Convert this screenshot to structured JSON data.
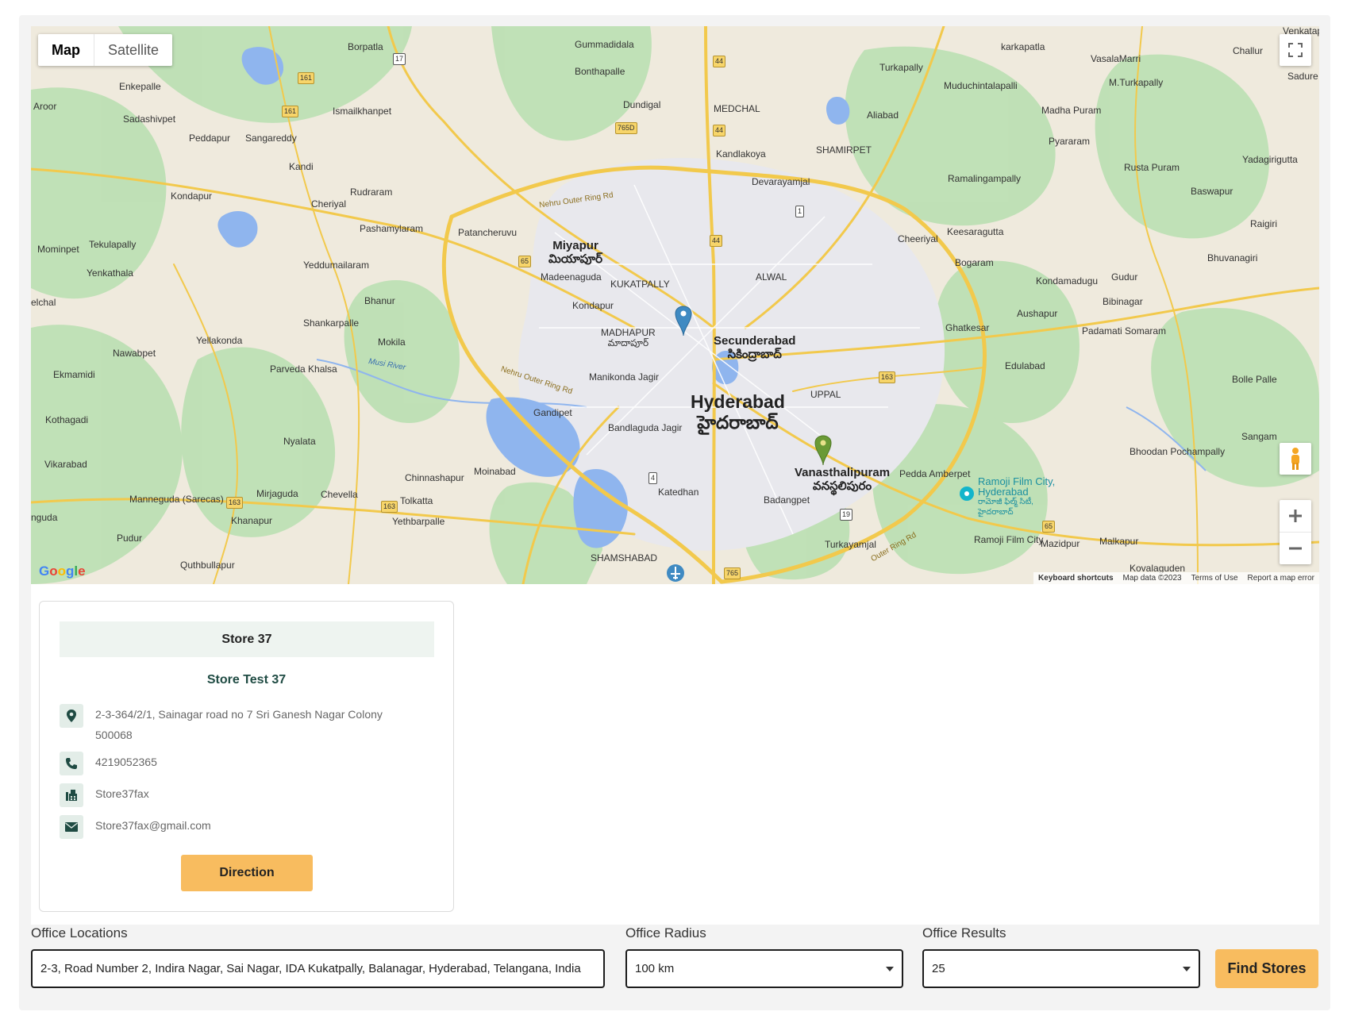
{
  "map": {
    "toggle": {
      "map_label": "Map",
      "satellite_label": "Satellite"
    },
    "labels": [
      {
        "text": "Gummadidala"
      },
      {
        "text": "Borpatla"
      },
      {
        "text": "Enkepalle"
      },
      {
        "text": "Aroor"
      },
      {
        "text": "Sadashivpet"
      },
      {
        "text": "Ismailkhanpet"
      },
      {
        "text": "Peddapur"
      },
      {
        "text": "Sangareddy"
      },
      {
        "text": "Kandi"
      },
      {
        "text": "Kondapur"
      },
      {
        "text": "Rudraram"
      },
      {
        "text": "Cheriyal"
      },
      {
        "text": "Pashamylaram"
      },
      {
        "text": "Patancheruvu"
      },
      {
        "text": "Mominpet"
      },
      {
        "text": "Tekulapally"
      },
      {
        "text": "Yenkathala"
      },
      {
        "text": "Yeddumailaram"
      },
      {
        "text": "Madeenaguda"
      },
      {
        "text": "Kondapur"
      },
      {
        "text": "Bhanur"
      },
      {
        "text": "Shankarpalle"
      },
      {
        "text": "Yellakonda"
      },
      {
        "text": "Nawabpet"
      },
      {
        "text": "Mokila"
      },
      {
        "text": "Ekmamidi"
      },
      {
        "text": "Parveda Khalsa"
      },
      {
        "text": "Kothagadi"
      },
      {
        "text": "Vikarabad"
      },
      {
        "text": "Nyalata"
      },
      {
        "text": "Chinnashapur"
      },
      {
        "text": "Moinabad"
      },
      {
        "text": "Gandipet"
      },
      {
        "text": "Manikonda Jagir"
      },
      {
        "text": "Bandlaguda Jagir"
      },
      {
        "text": "Manneguda (Sarecas)"
      },
      {
        "text": "Mirjaguda"
      },
      {
        "text": "Chevella"
      },
      {
        "text": "Tolkatta"
      },
      {
        "text": "Yethbarpalle"
      },
      {
        "text": "Khanapur"
      },
      {
        "text": "Pudur"
      },
      {
        "text": "Quthbullapur"
      },
      {
        "text": "Katedhan"
      },
      {
        "text": "Bonthapalle"
      },
      {
        "text": "Dundigal"
      },
      {
        "text": "MEDCHAL"
      },
      {
        "text": "Kandlakoya"
      },
      {
        "text": "Devarayamjal"
      },
      {
        "text": "Turkapally"
      },
      {
        "text": "Aliabad"
      },
      {
        "text": "SHAMIRPET"
      },
      {
        "text": "Muduchintalapalli"
      },
      {
        "text": "karkapatla"
      },
      {
        "text": "VasalaMarri"
      },
      {
        "text": "M.Turkapally"
      },
      {
        "text": "Madha Puram"
      },
      {
        "text": "Pyararam"
      },
      {
        "text": "Ramalingampally"
      },
      {
        "text": "Rusta Puram"
      },
      {
        "text": "Yadagirigutta"
      },
      {
        "text": "Baswapur"
      },
      {
        "text": "Raigiri"
      },
      {
        "text": "Bhuvanagiri"
      },
      {
        "text": "Cheeriyal"
      },
      {
        "text": "Keesaragutta"
      },
      {
        "text": "Bogaram"
      },
      {
        "text": "Kondamadugu"
      },
      {
        "text": "Gudur"
      },
      {
        "text": "Bibinagar"
      },
      {
        "text": "Aushapur"
      },
      {
        "text": "Ghatkesar"
      },
      {
        "text": "Padamati Somaram"
      },
      {
        "text": "Edulabad"
      },
      {
        "text": "Bolle Palle"
      },
      {
        "text": "Sangam"
      },
      {
        "text": "Bhoodan Pochampally"
      },
      {
        "text": "Pedda Amberpet"
      },
      {
        "text": "Badangpet"
      },
      {
        "text": "Turkayamjal"
      },
      {
        "text": "Mazidpur"
      },
      {
        "text": "Malkapur"
      },
      {
        "text": "Ramoji Film City"
      },
      {
        "text": "Kovalaguden"
      },
      {
        "text": "ALWAL"
      },
      {
        "text": "KUKATPALLY"
      },
      {
        "text": "UPPAL"
      },
      {
        "text": "SHAMSHABAD"
      },
      {
        "text": "Challur"
      },
      {
        "text": "Sadure"
      },
      {
        "text": "Venkatap"
      },
      {
        "text": "elchal"
      },
      {
        "text": "nguda"
      }
    ],
    "major_labels": [
      {
        "text": "Miyapur",
        "sub": "మియాపూర్"
      },
      {
        "text": "MADHAPUR",
        "sub": "మాదాపూర్"
      },
      {
        "text": "Secunderabad",
        "sub": "సికింద్రాబాద్"
      },
      {
        "text": "Vanasthalipuram",
        "sub": "వనస్థలిపురం"
      }
    ],
    "city": {
      "text": "Hyderabad",
      "sub": "హైదరాబాద్"
    },
    "poi": {
      "text": "Ramoji Film City, Hyderabad",
      "sub": "రామోజీ ఫిల్మ్ సిటీ, హైదరాబాద్"
    },
    "roads": [
      "Nehru Outer Ring Rd",
      "Nehru Outer Ring Rd",
      "Outer Ring Rd",
      "Musi River"
    ],
    "shields": [
      "161",
      "161",
      "17",
      "44",
      "44",
      "44",
      "765D",
      "65",
      "163",
      "163",
      "163",
      "4",
      "19",
      "65",
      "765",
      "1"
    ],
    "attribution": {
      "google": "Google",
      "keyboard": "Keyboard shortcuts",
      "data": "Map data ©2023",
      "terms": "Terms of Use",
      "report": "Report a map error"
    },
    "colors": {
      "land": "#efeadd",
      "green": "#9fd7a3",
      "urban": "#e9e9ee",
      "water": "#8fb5ee",
      "road": "#f2c94c",
      "pin_blue": "#3f8ac2",
      "pin_green": "#6a9a35"
    }
  },
  "store": {
    "header": "Store 37",
    "name": "Store Test 37",
    "address": "2-3-364/2/1, Sainagar road no 7 Sri Ganesh Nagar Colony 500068",
    "phone": "4219052365",
    "fax": "Store37fax",
    "email": "Store37fax@gmail.com",
    "direction_label": "Direction",
    "icons": [
      "map-pin-icon",
      "phone-icon",
      "fax-icon",
      "envelope-icon"
    ]
  },
  "form": {
    "location_label": "Office Locations",
    "location_value": "2-3, Road Number 2, Indira Nagar, Sai Nagar, IDA Kukatpally, Balanagar, Hyderabad, Telangana, India",
    "radius_label": "Office Radius",
    "radius_value": "100 km",
    "results_label": "Office Results",
    "results_value": "25",
    "find_label": "Find Stores"
  },
  "colors": {
    "accent": "#f8bc5f",
    "icon_bg": "#e3ede8",
    "icon_fg": "#1f4b43",
    "header_bg": "#eef4f0"
  }
}
